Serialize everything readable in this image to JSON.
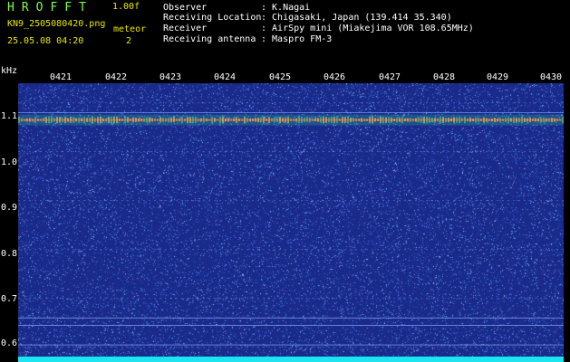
{
  "header": {
    "app_title": "HROFFT",
    "app_version": "1.00f",
    "file_name": "KN9_2505080420.png",
    "mode_label": "meteor",
    "capture_time": "25.05.08 04:20",
    "mode_count": "2"
  },
  "station_info": [
    {
      "label": "Observer",
      "value": ": K.Nagai"
    },
    {
      "label": "Receiving Location",
      "value": ": Chigasaki, Japan (139.414 35.340)"
    },
    {
      "label": "Receiver",
      "value": ": AirSpy mini (Miakejima VOR 108.65MHz)"
    },
    {
      "label": "Receiving antenna",
      "value": ": Maspro FM-3"
    }
  ],
  "spectrogram": {
    "unit_label": "kHz",
    "y_ticks": [
      "1.1",
      "1.0",
      "0.9",
      "0.8",
      "0.7",
      "0.6"
    ],
    "y_values": [
      1.1,
      1.0,
      0.9,
      0.8,
      0.7,
      0.6
    ],
    "y_range": [
      0.57,
      1.14
    ],
    "x_ticks": [
      "0421",
      "0422",
      "0423",
      "0424",
      "0425",
      "0426",
      "0427",
      "0428",
      "0429",
      "0430"
    ],
    "signal_khz": 1.065,
    "colors": {
      "background": "#1A2A8A",
      "noise": "#3C5AD2",
      "signal": "#E83A3A",
      "signal_glow": "#36E08A",
      "baseline": "#19E6F0"
    }
  }
}
